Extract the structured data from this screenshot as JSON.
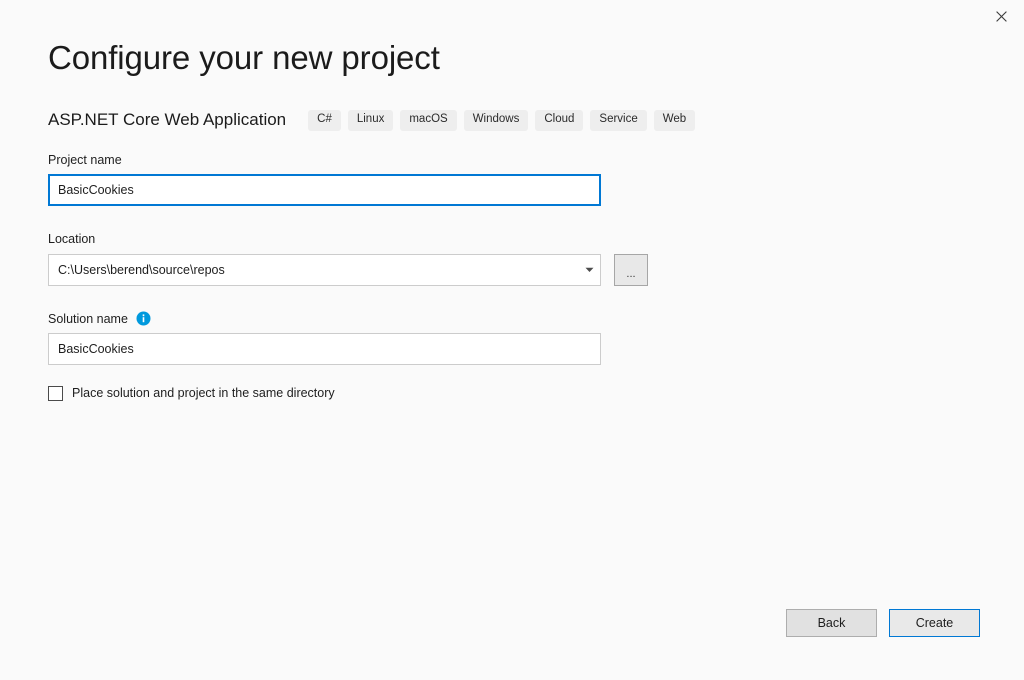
{
  "window": {
    "close_icon": "close-icon"
  },
  "header": {
    "title": "Configure your new project",
    "template_name": "ASP.NET Core Web Application",
    "tags": [
      "C#",
      "Linux",
      "macOS",
      "Windows",
      "Cloud",
      "Service",
      "Web"
    ]
  },
  "form": {
    "project_name": {
      "label": "Project name",
      "value": "BasicCookies"
    },
    "location": {
      "label": "Location",
      "value": "C:\\Users\\berend\\source\\repos",
      "dropdown_icon": "chevron-down-icon",
      "browse_label": "..."
    },
    "solution_name": {
      "label": "Solution name",
      "info_icon": "info-icon",
      "value": "BasicCookies"
    },
    "same_directory": {
      "label": "Place solution and project in the same directory",
      "checked": false
    }
  },
  "footer": {
    "back_label": "Back",
    "create_label": "Create"
  },
  "colors": {
    "page_background": "#fafafa",
    "accent": "#0078d4",
    "info_blue": "#0099dd",
    "tag_background": "#eeeeee",
    "text": "#1e1e1e",
    "button_face": "#e1e1e1",
    "border": "#cccccc"
  }
}
